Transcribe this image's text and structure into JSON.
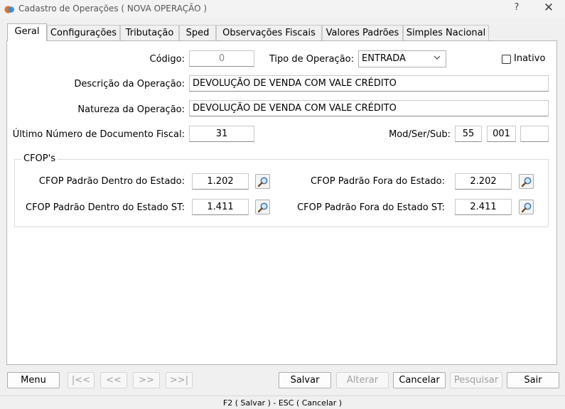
{
  "window": {
    "title": "Cadastro de Operações ( NOVA OPERAÇÃO )",
    "help": "?",
    "close": "✕"
  },
  "tabs": [
    {
      "label": "Geral"
    },
    {
      "label": "Configurações"
    },
    {
      "label": "Tributação"
    },
    {
      "label": "Sped"
    },
    {
      "label": "Observações Fiscais"
    },
    {
      "label": "Valores Padrões"
    },
    {
      "label": "Simples Nacional"
    }
  ],
  "form": {
    "codigo_label": "Código:",
    "codigo_value": "0",
    "tipo_label": "Tipo de Operação:",
    "tipo_value": "ENTRADA",
    "inativo_label": "Inativo",
    "descricao_label": "Descrição da Operação:",
    "descricao_value": "DEVOLUÇÃO DE VENDA COM VALE CRÉDITO",
    "natureza_label": "Natureza da Operação:",
    "natureza_value": "DEVOLUÇÃO DE VENDA COM VALE CRÉDITO",
    "ultimo_label": "Último Número de Documento Fiscal:",
    "ultimo_value": "31",
    "modsersub_label": "Mod/Ser/Sub:",
    "mod_value": "55",
    "ser_value": "001",
    "sub_value": ""
  },
  "cfops": {
    "title": "CFOP's",
    "dentro_label": "CFOP Padrão Dentro do Estado:",
    "dentro_value": "1.202",
    "fora_label": "CFOP Padrão Fora do Estado:",
    "fora_value": "2.202",
    "dentro_st_label": "CFOP Padrão Dentro do Estado ST:",
    "dentro_st_value": "1.411",
    "fora_st_label": "CFOP Padrão Fora do Estado ST:",
    "fora_st_value": "2.411"
  },
  "buttons": {
    "menu": "Menu",
    "first": "|<<",
    "prev": "<<",
    "next": ">>",
    "last": ">>|",
    "salvar": "Salvar",
    "alterar": "Alterar",
    "cancelar": "Cancelar",
    "pesquisar": "Pesquisar",
    "sair": "Sair"
  },
  "status": "F2 ( Salvar )  -  ESC ( Cancelar )",
  "colors": {
    "panel": "#ffffff",
    "window": "#f0f0f0",
    "accent_orange": "#e8702a",
    "accent_blue": "#2b8fd6"
  }
}
